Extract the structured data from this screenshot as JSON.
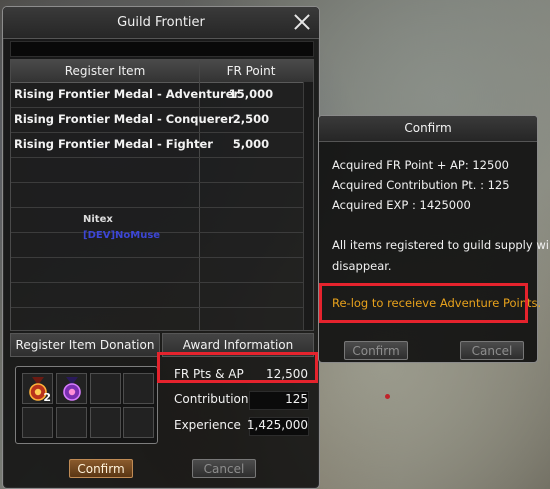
{
  "main_window": {
    "title": "Guild Frontier",
    "table": {
      "headers": [
        "Register Item",
        "FR Point"
      ],
      "rows": [
        {
          "name": "Rising Frontier Medal - Adventurer",
          "points": "15,000"
        },
        {
          "name": "Rising Frontier Medal - Conquerer",
          "points": "2,500"
        },
        {
          "name": "Rising Frontier Medal - Fighter",
          "points": "5,000"
        }
      ]
    },
    "donation_header": "Register Item Donation",
    "award_header": "Award Information",
    "slots": [
      {
        "filled": true,
        "icon": "red-medal-icon",
        "qty": "2"
      },
      {
        "filled": true,
        "icon": "purple-medal-icon",
        "qty": ""
      }
    ],
    "award": [
      {
        "label": "FR Pts & AP",
        "value": "12,500"
      },
      {
        "label": "Contribution",
        "value": "125"
      },
      {
        "label": "Experience",
        "value": "1,425,000"
      }
    ],
    "confirm_label": "Confirm",
    "cancel_label": "Cancel"
  },
  "confirm_dialog": {
    "title": "Confirm",
    "lines": [
      "Acquired FR Point + AP: 12500",
      "Acquired Contribution Pt. : 125",
      "Acquired EXP  : 1425000"
    ],
    "message_line1": "All items registered to guild supply will",
    "message_line2": "disappear.",
    "warning": "Re-log to receieve Adventure Points.",
    "confirm_label": "Confirm",
    "cancel_label": "Cancel"
  },
  "scene": {
    "nameplate_name": "Nitex",
    "nameplate_guild": "[DEV]NoMuse"
  },
  "colors": {
    "highlight": "#e5232d",
    "warning_text": "#e8a21c",
    "guild_tag": "#3c46d6"
  }
}
